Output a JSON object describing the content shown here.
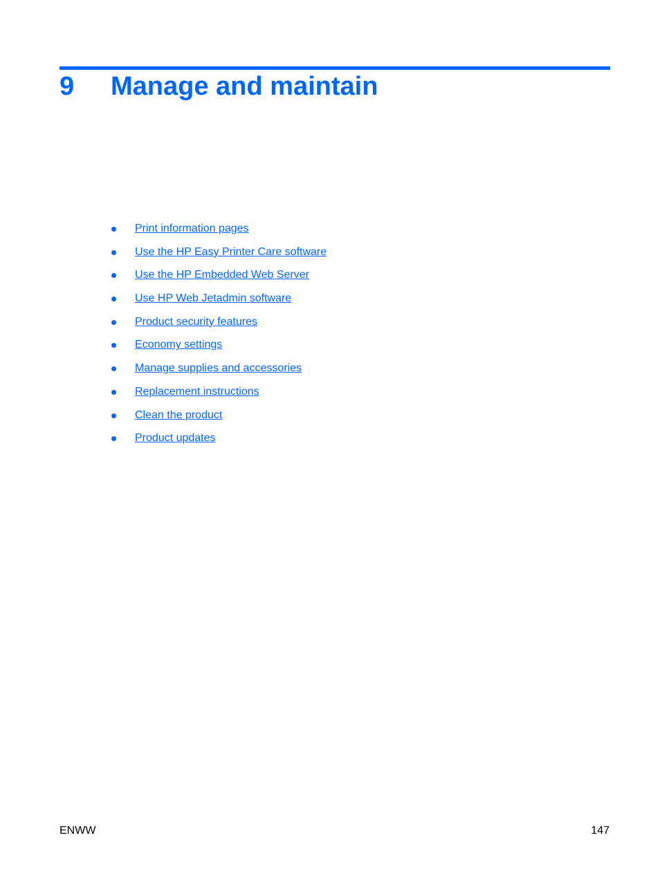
{
  "header": {
    "chapter_number": "9",
    "chapter_title": "Manage and maintain"
  },
  "toc": {
    "items": [
      {
        "label": "Print information pages"
      },
      {
        "label": "Use the HP Easy Printer Care software"
      },
      {
        "label": "Use the HP Embedded Web Server"
      },
      {
        "label": "Use HP Web Jetadmin software"
      },
      {
        "label": "Product security features"
      },
      {
        "label": "Economy settings"
      },
      {
        "label": "Manage supplies and accessories"
      },
      {
        "label": "Replacement instructions"
      },
      {
        "label": "Clean the product"
      },
      {
        "label": "Product updates"
      }
    ]
  },
  "footer": {
    "left": "ENWW",
    "page_number": "147"
  },
  "colors": {
    "accent": "#0066ff"
  }
}
